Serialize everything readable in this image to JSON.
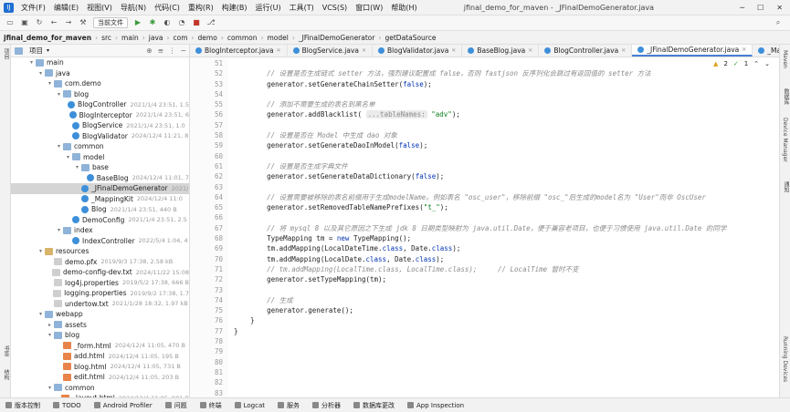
{
  "menubar": {
    "items": [
      "文件(F)",
      "编辑(E)",
      "视图(V)",
      "导航(N)",
      "代码(C)",
      "重构(R)",
      "构建(B)",
      "运行(U)",
      "工具(T)",
      "VCS(S)",
      "窗口(W)",
      "帮助(H)"
    ],
    "title": "jfinal_demo_for_maven - _JFinalDemoGenerator.java"
  },
  "toolbar": {
    "run_config": "当前文件"
  },
  "breadcrumb": [
    "jfinal_demo_for_maven",
    "src",
    "main",
    "java",
    "com",
    "demo",
    "common",
    "model",
    "_JFinalDemoGenerator",
    "getDataSource"
  ],
  "project": {
    "title": "项目"
  },
  "tree": [
    {
      "d": 2,
      "a": "▾",
      "i": "folder",
      "t": "main",
      "m": ""
    },
    {
      "d": 3,
      "a": "▾",
      "i": "folder",
      "t": "java",
      "m": ""
    },
    {
      "d": 4,
      "a": "▾",
      "i": "folder",
      "t": "com.demo",
      "m": ""
    },
    {
      "d": 5,
      "a": "▾",
      "i": "folder",
      "t": "blog",
      "m": ""
    },
    {
      "d": 6,
      "a": "",
      "i": "cls",
      "t": "BlogController",
      "m": "2021/1/4 23:51, 1.5"
    },
    {
      "d": 6,
      "a": "",
      "i": "cls",
      "t": "BlogInterceptor",
      "m": "2021/1/4 23:51, 6"
    },
    {
      "d": 6,
      "a": "",
      "i": "cls",
      "t": "BlogService",
      "m": "2021/1/4 23:51, 1.0"
    },
    {
      "d": 6,
      "a": "",
      "i": "cls",
      "t": "BlogValidator",
      "m": "2024/12/4 11:21, 8"
    },
    {
      "d": 5,
      "a": "▾",
      "i": "folder",
      "t": "common",
      "m": ""
    },
    {
      "d": 6,
      "a": "▾",
      "i": "folder",
      "t": "model",
      "m": ""
    },
    {
      "d": 7,
      "a": "▾",
      "i": "folder",
      "t": "base",
      "m": ""
    },
    {
      "d": 8,
      "a": "",
      "i": "cls",
      "t": "BaseBlog",
      "m": "2024/12/4 11:01, 7"
    },
    {
      "d": 7,
      "a": "",
      "i": "cls",
      "t": "_JFinalDemoGenerator",
      "m": "2021/",
      "sel": true
    },
    {
      "d": 7,
      "a": "",
      "i": "cls",
      "t": "_MappingKit",
      "m": "2024/12/4 11:0"
    },
    {
      "d": 7,
      "a": "",
      "i": "cls",
      "t": "Blog",
      "m": "2021/1/4 23:51, 440 B"
    },
    {
      "d": 6,
      "a": "",
      "i": "cls",
      "t": "DemoConfig",
      "m": "2021/1/4 23:51, 2.5"
    },
    {
      "d": 5,
      "a": "▾",
      "i": "folder",
      "t": "index",
      "m": ""
    },
    {
      "d": 6,
      "a": "",
      "i": "cls",
      "t": "IndexController",
      "m": "2022/5/4 1:04, 4"
    },
    {
      "d": 3,
      "a": "▾",
      "i": "rfolder",
      "t": "resources",
      "m": ""
    },
    {
      "d": 4,
      "a": "",
      "i": "file",
      "t": "demo.pfx",
      "m": "2019/9/3 17:38, 2.58 kB"
    },
    {
      "d": 4,
      "a": "",
      "i": "file",
      "t": "demo-config-dev.txt",
      "m": "2024/11/22 15:08"
    },
    {
      "d": 4,
      "a": "",
      "i": "file",
      "t": "log4j.properties",
      "m": "2019/5/2 17:38, 666 B"
    },
    {
      "d": 4,
      "a": "",
      "i": "file",
      "t": "logging.properties",
      "m": "2019/9/2 17:38, 1.7"
    },
    {
      "d": 4,
      "a": "",
      "i": "file",
      "t": "undertow.txt",
      "m": "2021/1/28 18:32, 1.97 kB"
    },
    {
      "d": 3,
      "a": "▾",
      "i": "folder",
      "t": "webapp",
      "m": ""
    },
    {
      "d": 4,
      "a": "▸",
      "i": "folder",
      "t": "assets",
      "m": ""
    },
    {
      "d": 4,
      "a": "▾",
      "i": "folder",
      "t": "blog",
      "m": ""
    },
    {
      "d": 5,
      "a": "",
      "i": "html",
      "t": "_form.html",
      "m": "2024/12/4 11:05, 470 B"
    },
    {
      "d": 5,
      "a": "",
      "i": "html",
      "t": "add.html",
      "m": "2024/12/4 11:05, 195 B"
    },
    {
      "d": 5,
      "a": "",
      "i": "html",
      "t": "blog.html",
      "m": "2024/12/4 11:05, 731 B"
    },
    {
      "d": 5,
      "a": "",
      "i": "html",
      "t": "edit.html",
      "m": "2024/12/4 11:05, 203 B"
    },
    {
      "d": 4,
      "a": "▾",
      "i": "folder",
      "t": "common",
      "m": ""
    },
    {
      "d": 5,
      "a": "",
      "i": "html",
      "t": "_layout.html",
      "m": "2024/12/4 11:05, 901 B"
    }
  ],
  "tabs": [
    {
      "label": "BlogInterceptor.java",
      "active": false
    },
    {
      "label": "BlogService.java",
      "active": false
    },
    {
      "label": "BlogValidator.java",
      "active": false
    },
    {
      "label": "BaseBlog.java",
      "active": false
    },
    {
      "label": "BlogController.java",
      "active": false
    },
    {
      "label": "_JFinalDemoGenerator.java",
      "active": true
    },
    {
      "label": "_MappingKit.ja",
      "active": false
    }
  ],
  "inspections": {
    "warnings": "2",
    "checks": "1"
  },
  "code": {
    "line_numbers": [
      "51",
      "52",
      "53",
      "54",
      "55",
      "56",
      "57",
      "58",
      "59",
      "60",
      "61",
      "62",
      "63",
      "64",
      "65",
      "66",
      "67",
      "68",
      "69",
      "70",
      "71",
      "72",
      "73",
      "74",
      "75",
      "76",
      "77",
      "78",
      "79",
      "80",
      "81",
      "82",
      "83"
    ],
    "lines": [
      [],
      [
        {
          "c": "cmt",
          "t": "        // 设置是否生成链式 setter 方法，强烈建议配置成 false，否则 fastjson 反序列化会跳过有返回值的 setter 方法"
        }
      ],
      [
        {
          "t": "        generator.setGenerateChainSetter("
        },
        {
          "c": "kw",
          "t": "false"
        },
        {
          "t": ");"
        }
      ],
      [],
      [
        {
          "c": "cmt",
          "t": "        // 添加不需要生成的表名到黑名单"
        }
      ],
      [
        {
          "t": "        generator.addBlacklist( "
        },
        {
          "c": "hint",
          "t": "...tableNames:"
        },
        {
          "t": " "
        },
        {
          "c": "str",
          "t": "\"adv\""
        },
        {
          "t": ");"
        }
      ],
      [],
      [
        {
          "c": "cmt",
          "t": "        // 设置是否在 Model 中生成 dao 对象"
        }
      ],
      [
        {
          "t": "        generator.setGenerateDaoInModel("
        },
        {
          "c": "kw",
          "t": "false"
        },
        {
          "t": ");"
        }
      ],
      [],
      [
        {
          "c": "cmt",
          "t": "        // 设置是否生成字典文件"
        }
      ],
      [
        {
          "t": "        generator.setGenerateDataDictionary("
        },
        {
          "c": "kw",
          "t": "false"
        },
        {
          "t": ");"
        }
      ],
      [],
      [
        {
          "c": "cmt",
          "t": "        // 设置需要被移除的表名前缀用于生成modelName。例如表名 \"osc_user\"，移除前缀 \"osc_\"后生成的model名为 \"User\"而非 OscUser"
        }
      ],
      [
        {
          "t": "        generator.setRemovedTableNamePrefixes("
        },
        {
          "c": "str",
          "t": "\"t_\""
        },
        {
          "t": ");"
        }
      ],
      [],
      [
        {
          "c": "cmt",
          "t": "        // 将 mysql 8 以及其它原因之下生成 jdk 8 日期类型映射为 java.util.Date，便于兼容老项目，也便于习惯使用 java.util.Date 的同学"
        }
      ],
      [
        {
          "t": "        TypeMapping tm = "
        },
        {
          "c": "kw",
          "t": "new"
        },
        {
          "t": " TypeMapping();"
        }
      ],
      [
        {
          "t": "        tm.addMapping(LocalDateTime."
        },
        {
          "c": "kw",
          "t": "class"
        },
        {
          "t": ", Date."
        },
        {
          "c": "kw",
          "t": "class"
        },
        {
          "t": ");"
        }
      ],
      [
        {
          "t": "        tm.addMapping(LocalDate."
        },
        {
          "c": "kw",
          "t": "class"
        },
        {
          "t": ", Date."
        },
        {
          "c": "kw",
          "t": "class"
        },
        {
          "t": ");"
        }
      ],
      [
        {
          "c": "cmt",
          "t": "        // tm.addMapping(LocalTime.class, LocalTime.class);     // LocalTime 暂时不变"
        }
      ],
      [
        {
          "t": "        generator.setTypeMapping(tm);"
        }
      ],
      [],
      [
        {
          "c": "cmt",
          "t": "        // 生成"
        }
      ],
      [
        {
          "t": "        generator.generate();"
        }
      ],
      [
        {
          "t": "    }"
        }
      ],
      [
        {
          "t": "}"
        }
      ],
      [],
      [],
      [],
      [],
      [],
      []
    ]
  },
  "statusbar": [
    "版本控制",
    "TODO",
    "Android Profiler",
    "问题",
    "终端",
    "Logcat",
    "服务",
    "分析器",
    "数据库更改",
    "App Inspection"
  ],
  "left_strip": [
    "项目",
    "书签",
    "结构"
  ],
  "right_strip": [
    "Maven",
    "数据库",
    "Device Manager",
    "通知",
    "Running Devices"
  ]
}
